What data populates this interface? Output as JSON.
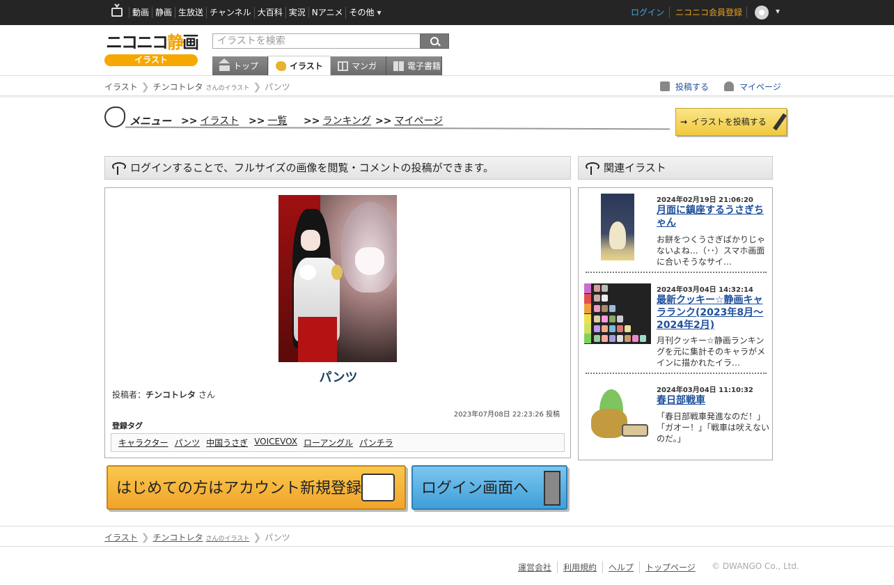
{
  "global_nav": {
    "items": [
      "動画",
      "静画",
      "生放送",
      "チャンネル",
      "大百科",
      "実況",
      "Nアニメ",
      "その他"
    ],
    "login": "ログイン",
    "register": "ニコニコ会員登録"
  },
  "logo": {
    "main_a": "ニコニコ",
    "main_b": "静",
    "main_c": "画",
    "sub": "イラスト"
  },
  "search": {
    "placeholder": "イラストを検索"
  },
  "tabs": [
    {
      "label": "トップ",
      "icon": "home-icon"
    },
    {
      "label": "イラスト",
      "icon": "palette-icon",
      "active": true
    },
    {
      "label": "マンガ",
      "icon": "manga-icon"
    },
    {
      "label": "電子書籍",
      "icon": "book-icon"
    }
  ],
  "breadcrumb": {
    "root": "イラスト",
    "user": "チンコトレタ",
    "user_suffix": "さんのイラスト",
    "current": "パンツ"
  },
  "util": {
    "post": "投稿する",
    "mypage": "マイページ"
  },
  "menu": {
    "label": "メニュー",
    "items": [
      {
        "arrow": ">>",
        "label": "イラスト"
      },
      {
        "arrow": ">>",
        "label": "一覧"
      },
      {
        "arrow": ">>",
        "label": "ランキング"
      },
      {
        "arrow": ">>",
        "label": "マイページ"
      }
    ],
    "post_button": "イラストを投稿する"
  },
  "notice": "ログインすることで、フルサイズの画像を閲覧・コメントの投稿ができます。",
  "illust": {
    "title": "パンツ",
    "poster_label": "投稿者：",
    "poster_name": "チンコトレタ",
    "poster_suffix": " さん",
    "posted_at": "2023年07月08日 22:23:26 投稿",
    "tag_label": "登録タグ",
    "tags": [
      "キャラクター",
      "パンツ",
      "中国うさぎ",
      "VOICEVOX",
      "ローアングル",
      "パンチラ"
    ]
  },
  "cta": {
    "register": "はじめての方はアカウント新規登録へ",
    "login": "ログイン画面へ"
  },
  "related": {
    "header": "関連イラスト",
    "items": [
      {
        "date": "2024年02月19日 21:06:20",
        "title": "月面に鎮座するうさぎちゃん",
        "desc": "お餅をつくうさぎばかりじゃないよね…（･･）スマホ画面に合いそうなサイ…"
      },
      {
        "date": "2024年03月04日 14:32:14",
        "title": "最新クッキー☆静画キャラランク(2023年8月～2024年2月)",
        "desc": "月刊クッキー☆静画ランキングを元に集計そのキャラがメインに描かれたイラ…"
      },
      {
        "date": "2024年03月04日 11:10:32",
        "title": "春日部戦車",
        "desc": "「春日部戦車発進なのだ！」「ガオー！」「戦車は吠えないのだ。」"
      }
    ]
  },
  "footer": {
    "links": [
      "運営会社",
      "利用規約",
      "ヘルプ",
      "トップページ"
    ],
    "copyright": "© DWANGO Co., Ltd."
  }
}
